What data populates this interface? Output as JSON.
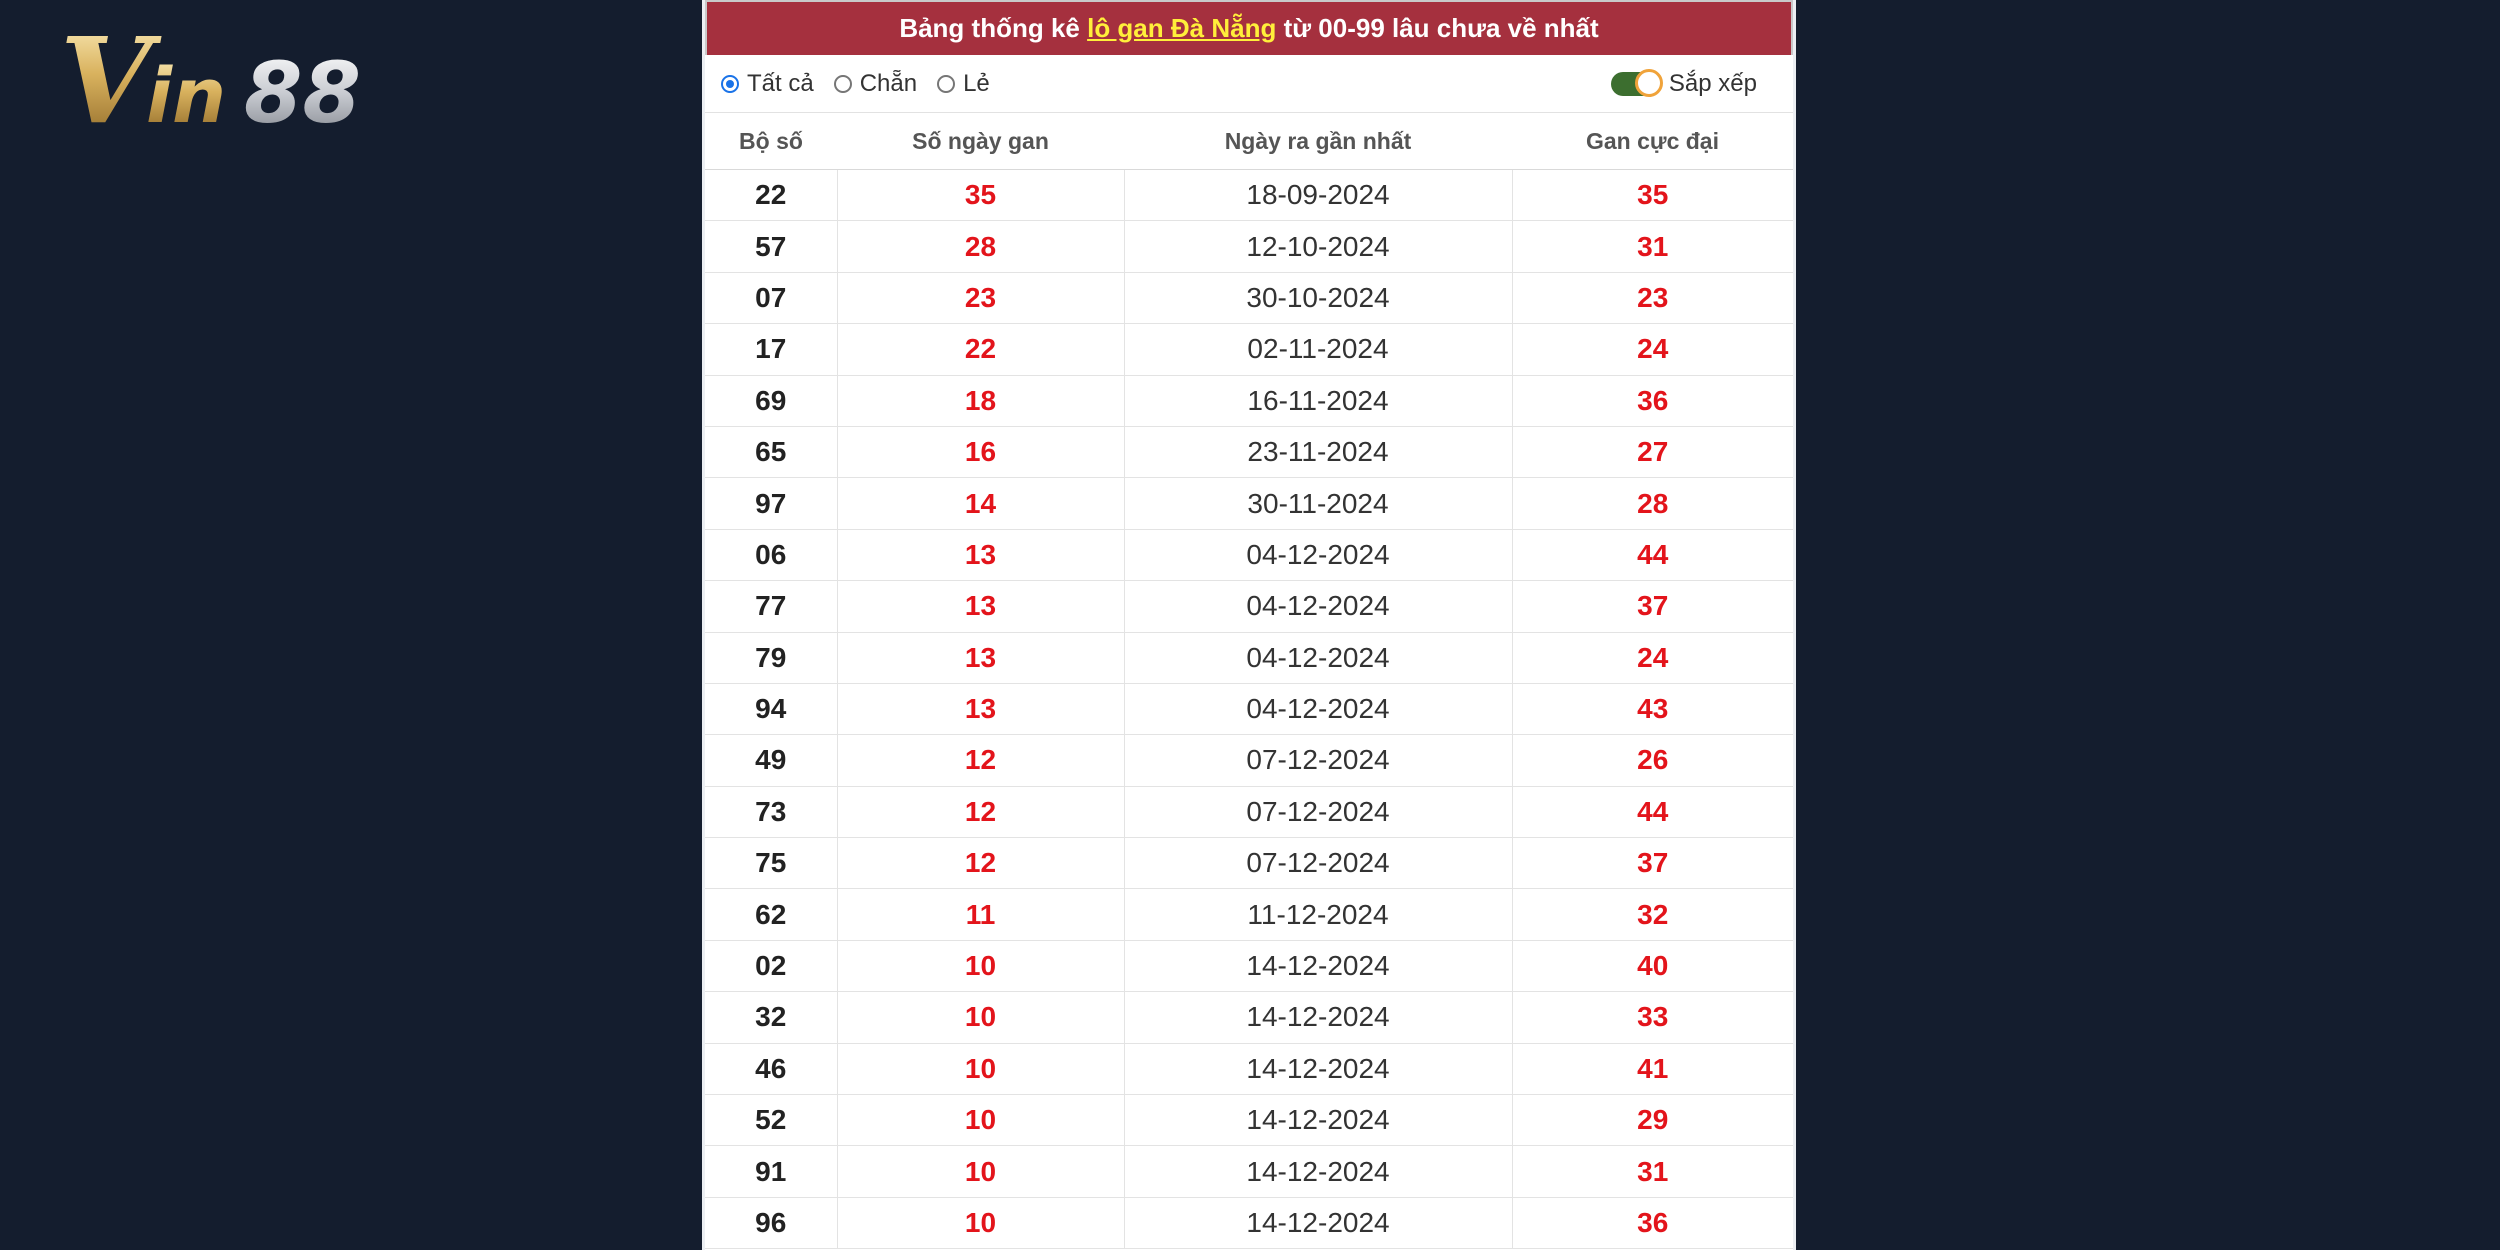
{
  "logo": {
    "text": "Vin88"
  },
  "title": {
    "prefix": "Bảng thống kê ",
    "highlight": "lô gan Đà Nẵng",
    "suffix": " từ 00-99 lâu chưa về nhất"
  },
  "filters": {
    "options": [
      "Tất cả",
      "Chẵn",
      "Lẻ"
    ],
    "selected": "Tất cả",
    "sort_label": "Sắp xếp",
    "sort_on": true
  },
  "colors": {
    "title_bg": "#a5303e",
    "highlight": "#ffef3a",
    "value_red": "#e3141b",
    "page_bg": "#141d2e"
  },
  "table": {
    "headers": [
      "Bộ số",
      "Số ngày gan",
      "Ngày ra gần nhất",
      "Gan cực đại"
    ],
    "rows": [
      [
        "22",
        "35",
        "18-09-2024",
        "35"
      ],
      [
        "57",
        "28",
        "12-10-2024",
        "31"
      ],
      [
        "07",
        "23",
        "30-10-2024",
        "23"
      ],
      [
        "17",
        "22",
        "02-11-2024",
        "24"
      ],
      [
        "69",
        "18",
        "16-11-2024",
        "36"
      ],
      [
        "65",
        "16",
        "23-11-2024",
        "27"
      ],
      [
        "97",
        "14",
        "30-11-2024",
        "28"
      ],
      [
        "06",
        "13",
        "04-12-2024",
        "44"
      ],
      [
        "77",
        "13",
        "04-12-2024",
        "37"
      ],
      [
        "79",
        "13",
        "04-12-2024",
        "24"
      ],
      [
        "94",
        "13",
        "04-12-2024",
        "43"
      ],
      [
        "49",
        "12",
        "07-12-2024",
        "26"
      ],
      [
        "73",
        "12",
        "07-12-2024",
        "44"
      ],
      [
        "75",
        "12",
        "07-12-2024",
        "37"
      ],
      [
        "62",
        "11",
        "11-12-2024",
        "32"
      ],
      [
        "02",
        "10",
        "14-12-2024",
        "40"
      ],
      [
        "32",
        "10",
        "14-12-2024",
        "33"
      ],
      [
        "46",
        "10",
        "14-12-2024",
        "41"
      ],
      [
        "52",
        "10",
        "14-12-2024",
        "29"
      ],
      [
        "91",
        "10",
        "14-12-2024",
        "31"
      ],
      [
        "96",
        "10",
        "14-12-2024",
        "36"
      ]
    ]
  }
}
